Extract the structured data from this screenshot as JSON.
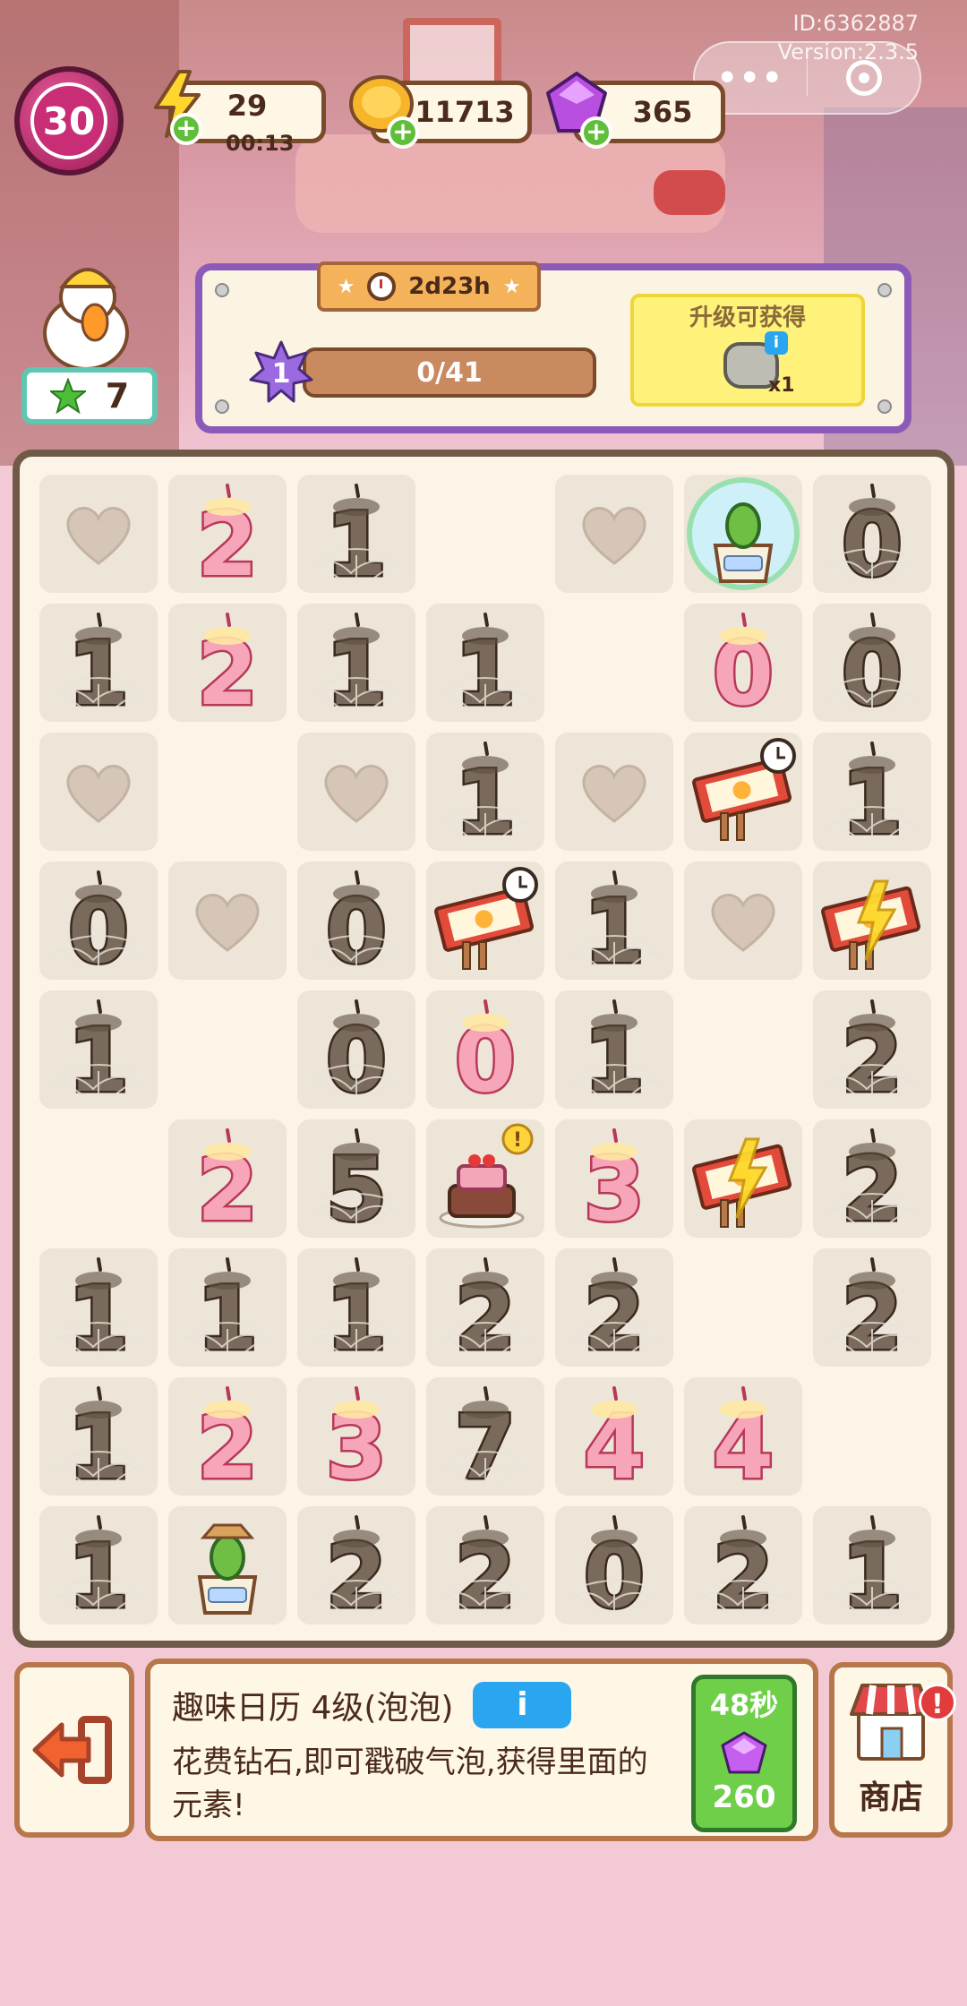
{
  "header": {
    "id_text": "ID:6362887",
    "version_text": "Version:2.3.5",
    "level": "30",
    "energy": "29",
    "energy_timer": "00:13",
    "coins": "11713",
    "gems": "365",
    "stars": "7"
  },
  "mini_program": {
    "more_label": "•••"
  },
  "event": {
    "time_left": "2d23h",
    "rank": "1",
    "progress_text": "0/41",
    "progress": 0,
    "reward_title": "升级可获得",
    "reward_qty": "x1",
    "reward_info": "i"
  },
  "board": {
    "rows": [
      [
        "heart",
        "pink-2",
        "web-1",
        "empty",
        "heart",
        "bubble-cactus",
        "web-0"
      ],
      [
        "web-1",
        "pink-2",
        "web-1",
        "web-1",
        "empty",
        "pink-0",
        "web-0"
      ],
      [
        "heart",
        "empty",
        "heart",
        "web-1",
        "heart",
        "matchbox-clock",
        "web-1"
      ],
      [
        "web-0",
        "heart",
        "web-0",
        "matchbox-clock",
        "web-1",
        "heart",
        "matchbox-bolt"
      ],
      [
        "web-1",
        "empty",
        "web-0",
        "pink-0",
        "web-1",
        "empty",
        "web-2"
      ],
      [
        "empty",
        "pink-2",
        "web-5",
        "cake",
        "pink-3",
        "matchbox-bolt",
        "web-2"
      ],
      [
        "web-1",
        "web-1",
        "web-1",
        "web-2",
        "web-2",
        "empty",
        "web-2"
      ],
      [
        "web-1",
        "pink-2",
        "pink-3",
        "web-7",
        "pink-4",
        "pink-4",
        "empty"
      ],
      [
        "web-1",
        "cactus",
        "web-2",
        "web-2",
        "web-0",
        "web-2",
        "web-1"
      ]
    ]
  },
  "info": {
    "title": "趣味日历 4级(泡泡)",
    "info_button": "i",
    "description": "花费钻石,即可戳破气泡,获得里面的元素!",
    "timer": "48秒",
    "cost": "260"
  },
  "shop": {
    "label": "商店",
    "alert": "!"
  }
}
